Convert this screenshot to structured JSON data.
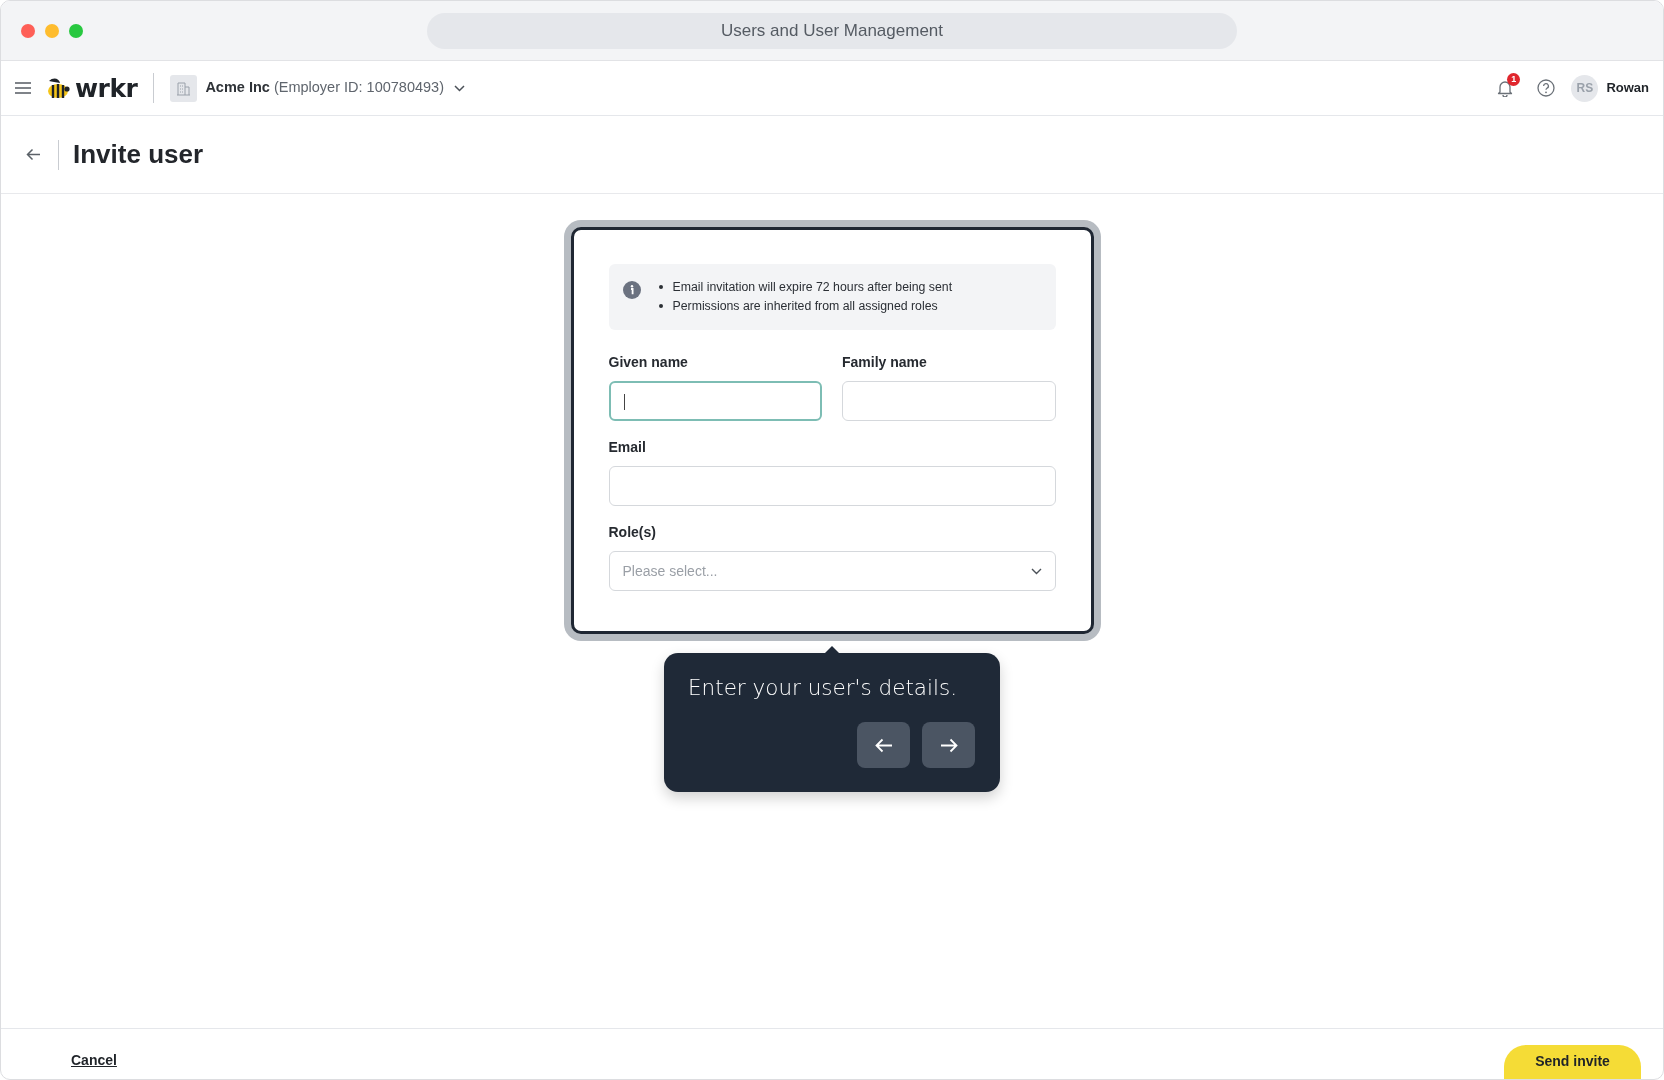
{
  "window": {
    "title": "Users and User Management"
  },
  "topbar": {
    "logo": "wrkr",
    "employer": {
      "name": "Acme Inc",
      "detail": "(Employer ID: 100780493)"
    },
    "notifications": {
      "count": "1"
    },
    "user": {
      "initials": "RS",
      "name": "Rowan"
    }
  },
  "page": {
    "title": "Invite user"
  },
  "info": {
    "items": [
      "Email invitation will expire 72 hours after being sent",
      "Permissions are inherited from all assigned roles"
    ]
  },
  "form": {
    "rows": [
      {
        "fields": [
          {
            "kind": "text",
            "label": "Given name",
            "focused": true
          },
          {
            "kind": "text",
            "label": "Family name",
            "focused": false
          }
        ]
      },
      {
        "fields": [
          {
            "kind": "text",
            "label": "Email",
            "focused": false
          }
        ]
      },
      {
        "fields": [
          {
            "kind": "select",
            "label": "Role(s)",
            "placeholder": "Please select...",
            "focused": false
          }
        ]
      }
    ]
  },
  "tour": {
    "text": "Enter your user's details."
  },
  "footer": {
    "cancel": "Cancel",
    "submit": "Send invite"
  }
}
